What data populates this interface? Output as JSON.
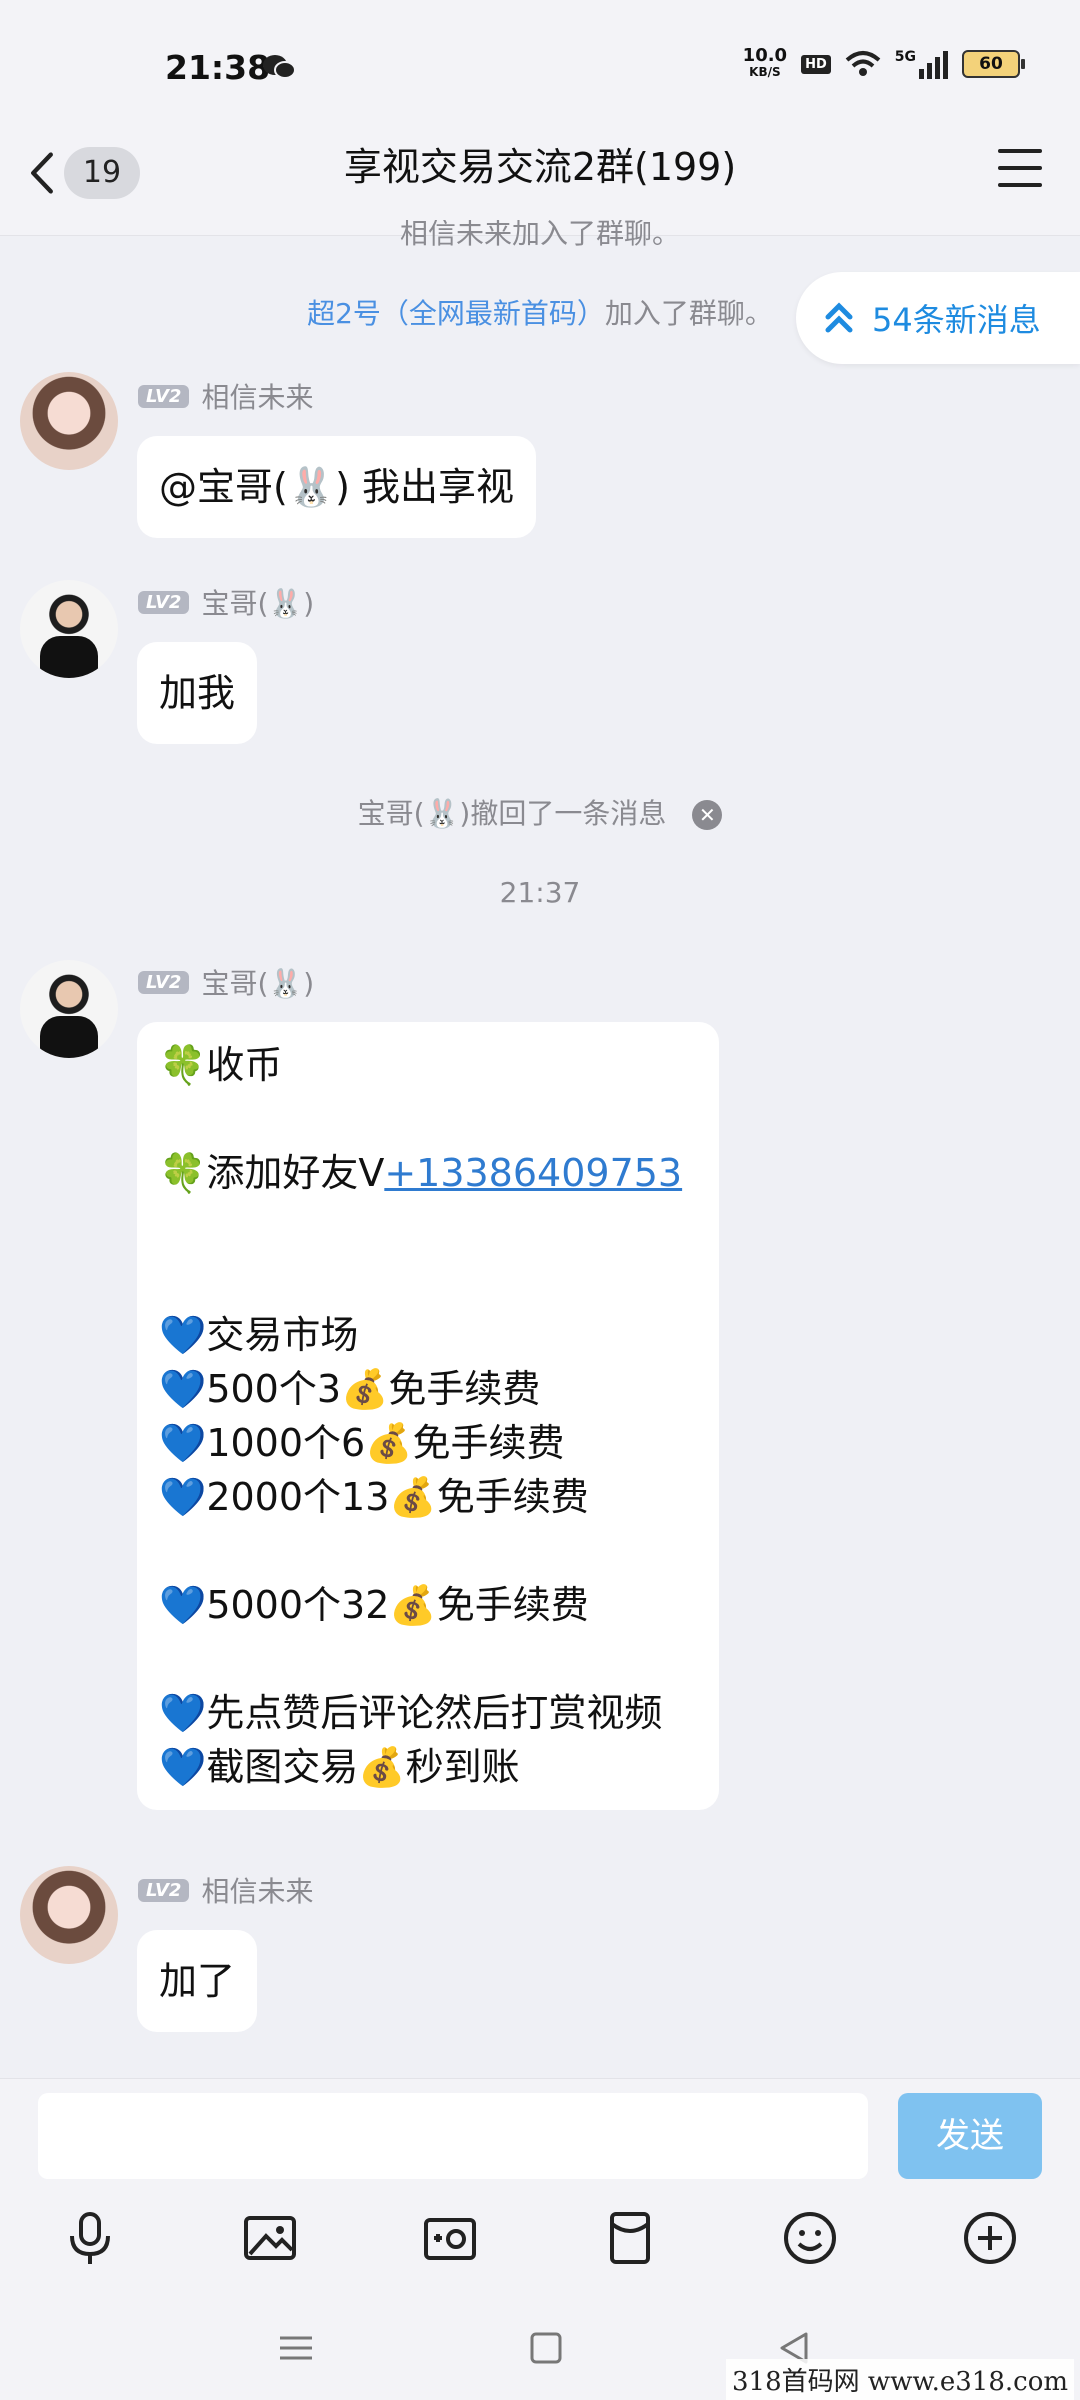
{
  "status_bar": {
    "time": "21:38",
    "net_speed": "10.0",
    "net_unit": "KB/S",
    "hd": "HD",
    "signal": "5G",
    "battery": "60"
  },
  "header": {
    "unread_count": "19",
    "title": "享视交易交流2群(199)"
  },
  "chat": {
    "partial_top": "相信未来加入了群聊。",
    "join_name": "超2号（全网最新首码）",
    "join_text": "加入了群聊。",
    "new_messages": "54条新消息",
    "messages": [
      {
        "level": "LV2",
        "name": "相信未来",
        "text": "@宝哥(🐰) 我出享视"
      },
      {
        "level": "LV2",
        "name": "宝哥(🐰)",
        "text": "加我"
      },
      {
        "level": "LV2",
        "name": "宝哥(🐰)",
        "lines": [
          "🍀收币",
          "",
          "🍀添加好友V",
          "",
          "",
          "💙交易市场",
          "💙500个3💰免手续费",
          "💙1000个6💰免手续费",
          "💙2000个13💰免手续费",
          "",
          "💙5000个32💰免手续费",
          "",
          "💙先点赞后评论然后打赏视频",
          "💙截图交易💰秒到账"
        ],
        "phone": "+13386409753"
      },
      {
        "level": "LV2",
        "name": "相信未来",
        "text": "加了"
      }
    ],
    "recall_notice": "宝哥(🐰)撤回了一条消息",
    "timestamp": "21:37"
  },
  "composer": {
    "send_label": "发送"
  },
  "watermark": "318首码网  www.e318.com"
}
